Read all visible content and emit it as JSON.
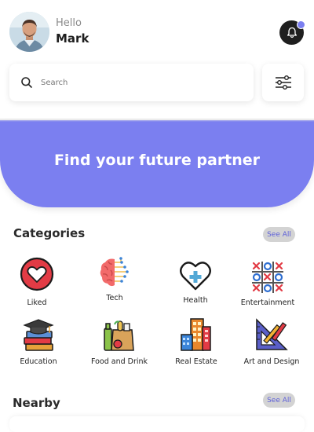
{
  "header": {
    "greeting": "Hello",
    "user_name": "Mark",
    "avatar_icon": "person-avatar",
    "notification_icon": "bell-icon"
  },
  "search": {
    "placeholder": "Search",
    "icon": "search-icon",
    "filter_icon": "sliders-icon"
  },
  "banner": {
    "text": "Find your future partner",
    "color": "#7b7ff0"
  },
  "categories": {
    "title": "Categories",
    "see_all_label": "See All",
    "items": [
      {
        "label": "Liked",
        "icon": "heart-icon"
      },
      {
        "label": "Tech",
        "icon": "brain-circuit-icon"
      },
      {
        "label": "Health",
        "icon": "heart-plus-icon"
      },
      {
        "label": "Entertainment",
        "icon": "tic-tac-toe-icon"
      },
      {
        "label": "Education",
        "icon": "graduation-books-icon"
      },
      {
        "label": "Food and Drink",
        "icon": "grocery-bag-icon"
      },
      {
        "label": "Real Estate",
        "icon": "buildings-icon"
      },
      {
        "label": "Art and Design",
        "icon": "ruler-pencil-icon"
      }
    ]
  },
  "nearby": {
    "title": "Nearby",
    "see_all_label": "See All"
  },
  "colors": {
    "accent": "#7b7ff0",
    "see_all_text": "#5d5fd8",
    "see_all_bg": "#d3d3d3"
  }
}
